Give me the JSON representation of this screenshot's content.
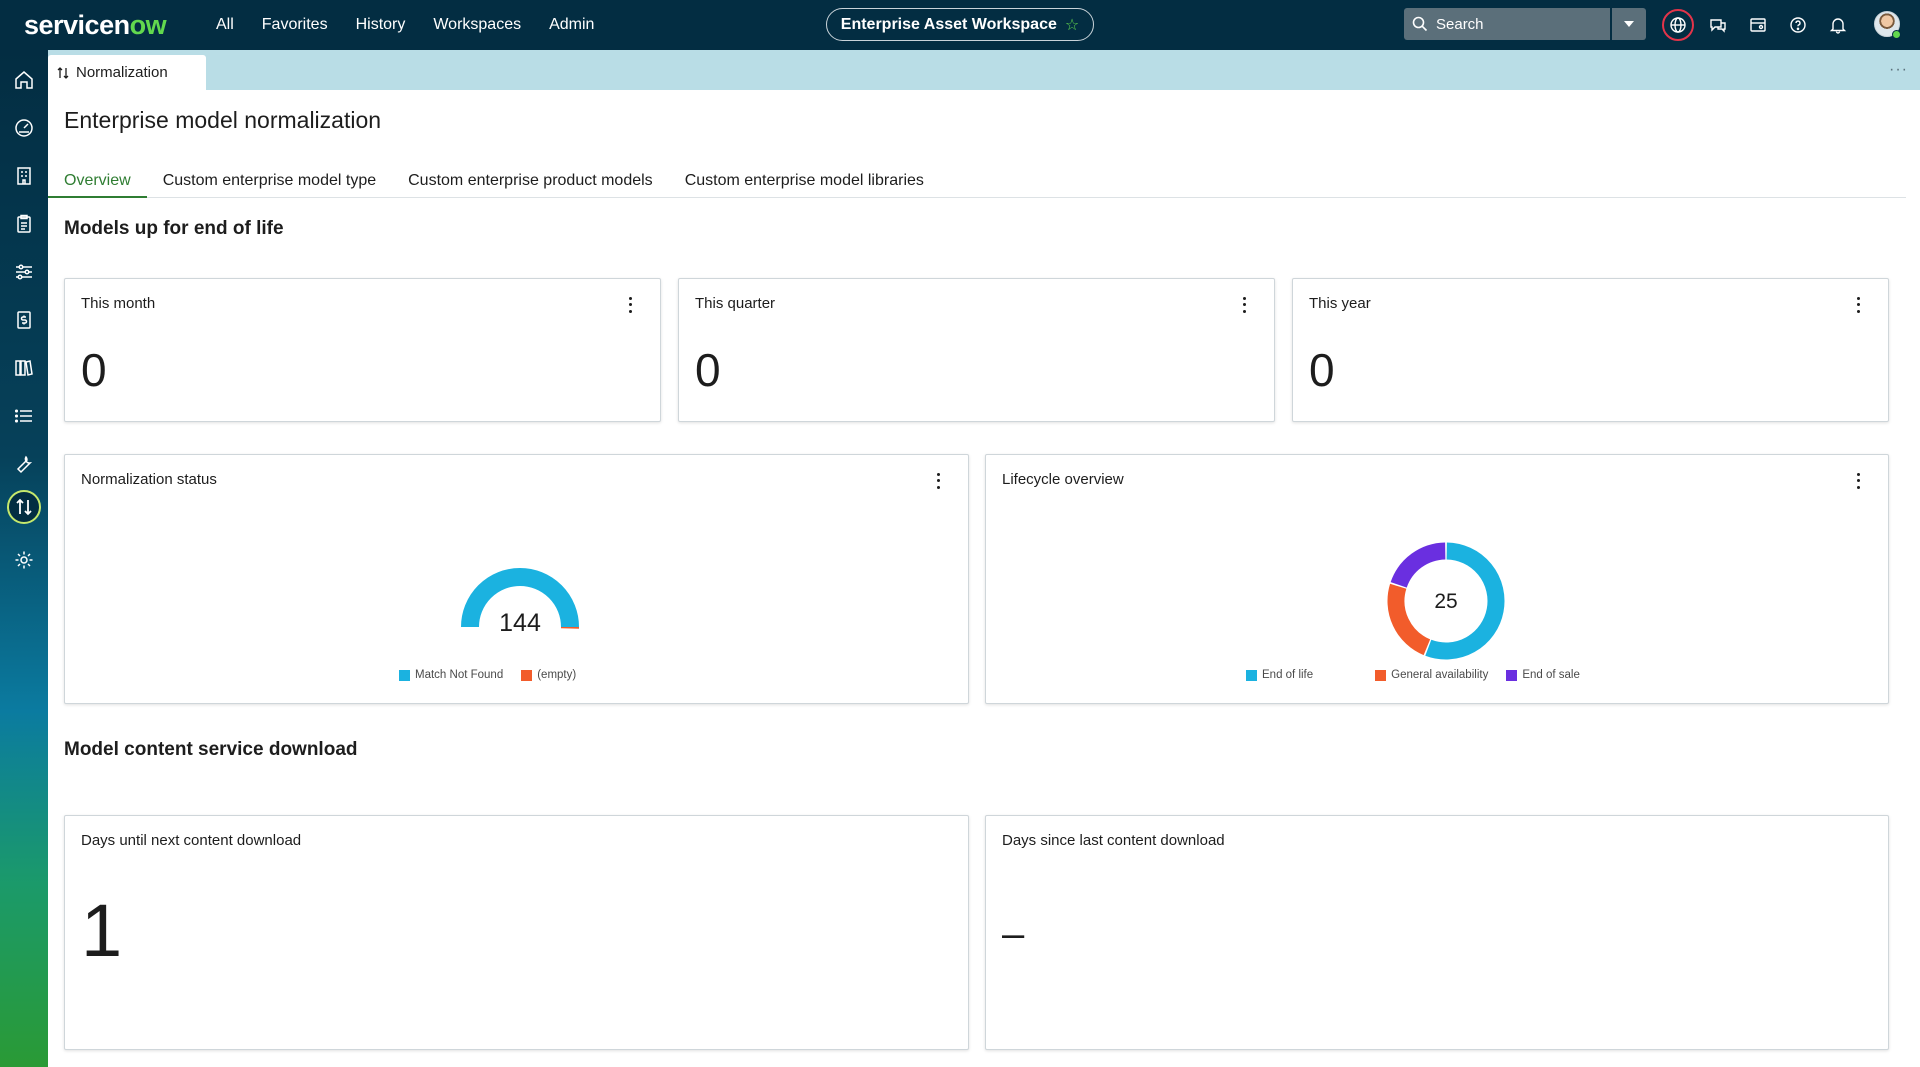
{
  "topbar": {
    "logo_main": "servicen",
    "logo_accent": "ow",
    "nav": [
      "All",
      "Favorites",
      "History",
      "Workspaces",
      "Admin"
    ],
    "workspace": "Enterprise Asset Workspace",
    "search_placeholder": "Search",
    "icons": [
      "globe-icon",
      "chat-icon",
      "card-icon",
      "help-icon",
      "bell-icon"
    ]
  },
  "rail": {
    "icons": [
      "home-icon",
      "dashboard-icon",
      "building-icon",
      "clipboard-icon",
      "sliders-icon",
      "billing-icon",
      "library-icon",
      "list-icon",
      "wrench-icon",
      "normalization-icon",
      "settings-icon"
    ]
  },
  "page_tab": {
    "label": "Normalization"
  },
  "page": {
    "title": "Enterprise model normalization"
  },
  "tabs": [
    "Overview",
    "Custom enterprise model type",
    "Custom enterprise product models",
    "Custom enterprise model libraries"
  ],
  "sections": {
    "eol": "Models up for end of life",
    "download": "Model content service download"
  },
  "eol_cards": [
    {
      "title": "This month",
      "value": "0"
    },
    {
      "title": "This quarter",
      "value": "0"
    },
    {
      "title": "This year",
      "value": "0"
    }
  ],
  "normalization": {
    "title": "Normalization status",
    "center_label": "144",
    "legend": [
      {
        "label": "Match Not Found",
        "color": "#1bb2e0"
      },
      {
        "label": "(empty)",
        "color": "#f25c2b"
      }
    ]
  },
  "lifecycle": {
    "title": "Lifecycle overview",
    "center_label": "25",
    "legend": [
      {
        "label": "End of life",
        "color": "#1bb2e0"
      },
      {
        "label": "General availability",
        "color": "#f25c2b"
      },
      {
        "label": "End of sale",
        "color": "#6a2fe0"
      }
    ]
  },
  "download_cards": [
    {
      "title": "Days until next content download",
      "value": "1"
    },
    {
      "title": "Days since last content download",
      "value": "–"
    }
  ],
  "chart_data": [
    {
      "type": "pie",
      "title": "Normalization status",
      "categories": [
        "Match Not Found",
        "(empty)"
      ],
      "values": [
        144,
        0
      ],
      "total": 144
    },
    {
      "type": "pie",
      "title": "Lifecycle overview",
      "categories": [
        "End of life",
        "General availability",
        "End of sale"
      ],
      "values": [
        14,
        6,
        5
      ],
      "total": 25
    }
  ]
}
